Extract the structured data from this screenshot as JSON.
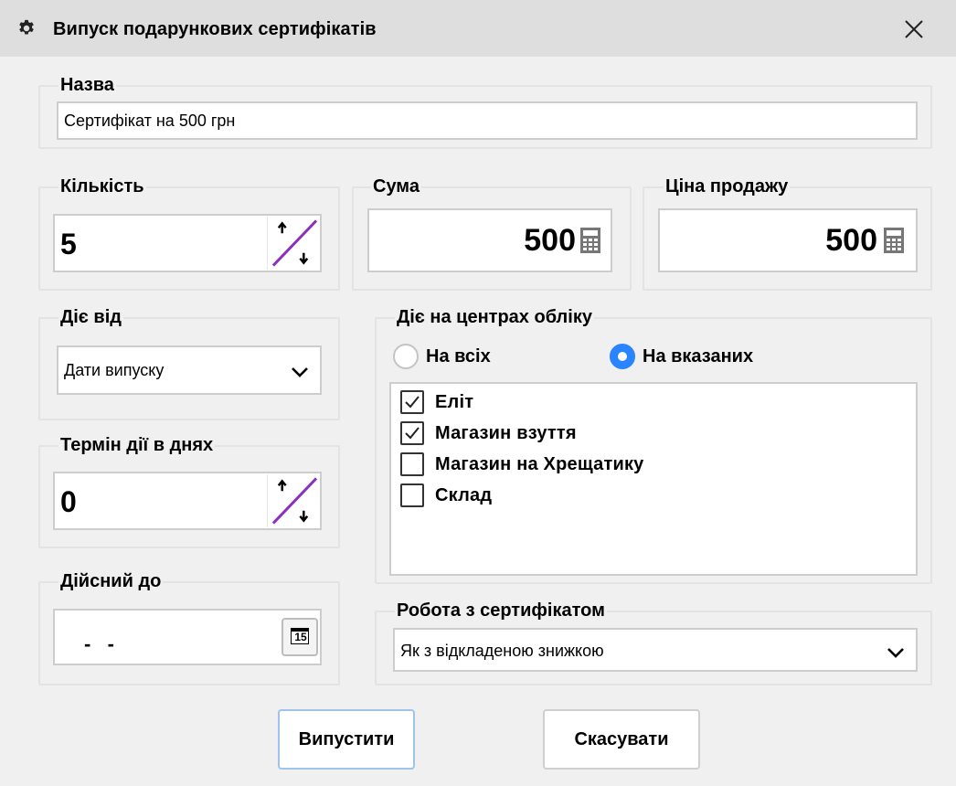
{
  "window": {
    "title": "Випуск подарункових сертифікатів",
    "title_icon": "gear-icon",
    "close_icon": "close-icon"
  },
  "name_group": {
    "label": "Назва",
    "value": "Сертифікат на 500 грн"
  },
  "quantity_group": {
    "label": "Кількість",
    "value": "5",
    "spin_icon": "spinner-arrows-icon"
  },
  "sum_group": {
    "label": "Сума",
    "value": "500",
    "icon": "calculator-icon"
  },
  "sale_price_group": {
    "label": "Ціна продажу",
    "value": "500",
    "icon": "calculator-icon"
  },
  "valid_from_group": {
    "label": "Діє від",
    "selected": "Дати випуску",
    "icon": "chevron-down-icon"
  },
  "duration_group": {
    "label": "Термін дії в днях",
    "value": "0",
    "spin_icon": "spinner-arrows-icon"
  },
  "valid_until_group": {
    "label": "Дійсний до",
    "value": "-   -",
    "calendar_day": "15",
    "icon": "calendar-icon"
  },
  "centers_group": {
    "label": "Діє на центрах обліку",
    "radio_all": {
      "label": "На всіх",
      "selected": false
    },
    "radio_selected": {
      "label": "На вказаних",
      "selected": true
    },
    "items": [
      {
        "label": "Еліт",
        "checked": true
      },
      {
        "label": "Магазин взуття",
        "checked": true
      },
      {
        "label": "Магазин на Хрещатику",
        "checked": false
      },
      {
        "label": "Склад",
        "checked": false
      }
    ]
  },
  "work_group": {
    "label": "Робота з сертифікатом",
    "selected": "Як з відкладеною знижкою",
    "icon": "chevron-down-icon"
  },
  "buttons": {
    "issue": "Випустити",
    "cancel": "Скасувати"
  },
  "colors": {
    "accent": "#2b84ff",
    "spin_slash": "#8a2fc0",
    "titlebar": "#dedede",
    "background": "#f0f0f0"
  }
}
